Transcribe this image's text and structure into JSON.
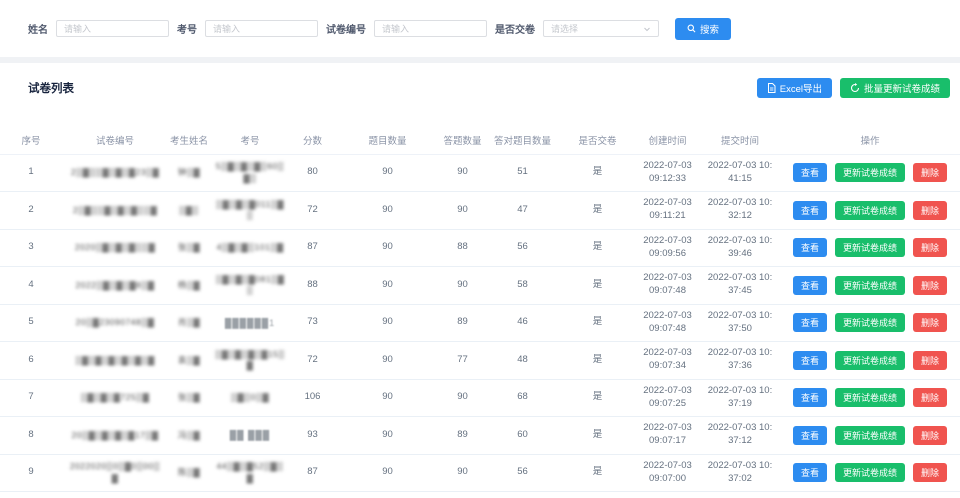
{
  "theme": {
    "primary": "#2d8cf0",
    "success": "#19be6b",
    "danger": "#f0544f",
    "background": "#f0f2f5"
  },
  "search_form": {
    "fields": [
      {
        "label": "姓名",
        "type": "input",
        "placeholder": "请输入"
      },
      {
        "label": "考号",
        "type": "input",
        "placeholder": "请输入"
      },
      {
        "label": "试卷编号",
        "type": "input",
        "placeholder": "请输入"
      },
      {
        "label": "是否交卷",
        "type": "select",
        "placeholder": "请选择"
      }
    ],
    "search_button": "搜索"
  },
  "toolbar": {
    "title": "试卷列表",
    "excel_button": "Excel导出",
    "batch_update_button": "批量更新试卷成绩"
  },
  "table": {
    "columns": [
      "序号",
      "试卷编号",
      "考生姓名",
      "考号",
      "分数",
      "题目数量",
      "答题数量",
      "答对题目数量",
      "是否交卷",
      "创建时间",
      "提交时间",
      "操作"
    ],
    "actions": {
      "view": "查看",
      "update": "更新试卷成绩",
      "delete": "删除"
    },
    "rows": [
      {
        "no": "1",
        "exam_no": "2▒▓▒▒▓▒▓▒▓23▒▓",
        "student": "钟▒▓",
        "exam_id": "5▒▓▒▓▒▓▒60▒▓▒",
        "score": "80",
        "questions": "90",
        "answered": "90",
        "correct": "51",
        "submitted": "是",
        "created": "2022-07-03 09:12:33",
        "submit_time": "2022-07-03 10:41:15",
        "mask": {
          "exam_no": "mosaic",
          "student": "mosaic",
          "exam_id": "mosaic"
        }
      },
      {
        "no": "2",
        "exam_no": "2▒▓▒▒▓▒▓▒▓▒▒▓",
        "student": "▒▓▒",
        "exam_id": "▒▓▒▓▒▓011▒▓▒",
        "score": "72",
        "questions": "90",
        "answered": "90",
        "correct": "47",
        "submitted": "是",
        "created": "2022-07-03 09:11:21",
        "submit_time": "2022-07-03 10:32:12",
        "mask": {
          "exam_no": "mosaic",
          "student": "mosaic",
          "exam_id": "mosaic"
        }
      },
      {
        "no": "3",
        "exam_no": "2020▒▓▒▓▒▓▒▒▓",
        "student": "张▒▓",
        "exam_id": "4▒▓▒▓▒101▒▓",
        "score": "87",
        "questions": "90",
        "answered": "88",
        "correct": "56",
        "submitted": "是",
        "created": "2022-07-03 09:09:56",
        "submit_time": "2022-07-03 10:39:46",
        "mask": {
          "exam_no": "mosaic",
          "student": "mosaic",
          "exam_id": "mosaic"
        }
      },
      {
        "no": "4",
        "exam_no": "2022▒▓▒▓▒▓8▒▓",
        "student": "杨▒▓",
        "exam_id": "▒▓▒▓▒▓081▒▓▒",
        "score": "88",
        "questions": "90",
        "answered": "90",
        "correct": "58",
        "submitted": "是",
        "created": "2022-07-03 09:07:48",
        "submit_time": "2022-07-03 10:37:45",
        "mask": {
          "exam_no": "mosaic",
          "student": "mosaic",
          "exam_id": "mosaic"
        }
      },
      {
        "no": "5",
        "exam_no": "20▒▓23090748▒▓",
        "student": "肖▒▓",
        "exam_id": "██████1",
        "score": "73",
        "questions": "90",
        "answered": "89",
        "correct": "46",
        "submitted": "是",
        "created": "2022-07-03 09:07:48",
        "submit_time": "2022-07-03 10:37:50",
        "mask": {
          "exam_no": "mosaic",
          "student": "mosaic",
          "exam_id": "solid"
        }
      },
      {
        "no": "6",
        "exam_no": "▒▓▒▓▒▓▒▓▒▓▒▓",
        "student": "袁▒▓",
        "exam_id": "▒▓▒▓▒▓▒▓15▒▓",
        "score": "72",
        "questions": "90",
        "answered": "77",
        "correct": "48",
        "submitted": "是",
        "created": "2022-07-03 09:07:34",
        "submit_time": "2022-07-03 10:37:36",
        "mask": {
          "exam_no": "mosaic",
          "student": "mosaic",
          "exam_id": "mosaic"
        }
      },
      {
        "no": "7",
        "exam_no": "▒▓▒▓▒▓725▒▓",
        "student": "张▒▓",
        "exam_id": "▒▓▒0▒▓",
        "score": "106",
        "questions": "90",
        "answered": "90",
        "correct": "68",
        "submitted": "是",
        "created": "2022-07-03 09:07:25",
        "submit_time": "2022-07-03 10:37:19",
        "mask": {
          "exam_no": "mosaic",
          "student": "mosaic",
          "exam_id": "mosaic"
        }
      },
      {
        "no": "8",
        "exam_no": "20▒▓▒▓▒▓▒▓17▒▓",
        "student": "冯▒▓",
        "exam_id": "██ ███",
        "score": "93",
        "questions": "90",
        "answered": "89",
        "correct": "60",
        "submitted": "是",
        "created": "2022-07-03 09:07:17",
        "submit_time": "2022-07-03 10:37:12",
        "mask": {
          "exam_no": "mosaic",
          "student": "mosaic",
          "exam_id": "solid"
        }
      },
      {
        "no": "9",
        "exam_no": "2022020▒0▒▓0▒00▒▓",
        "student": "陈▒▓",
        "exam_id": "44▒▓▒▓52▒▓▒▓",
        "score": "87",
        "questions": "90",
        "answered": "90",
        "correct": "56",
        "submitted": "是",
        "created": "2022-07-03 09:07:00",
        "submit_time": "2022-07-03 10:37:02",
        "mask": {
          "exam_no": "mosaic",
          "student": "mosaic",
          "exam_id": "mosaic"
        }
      }
    ]
  }
}
